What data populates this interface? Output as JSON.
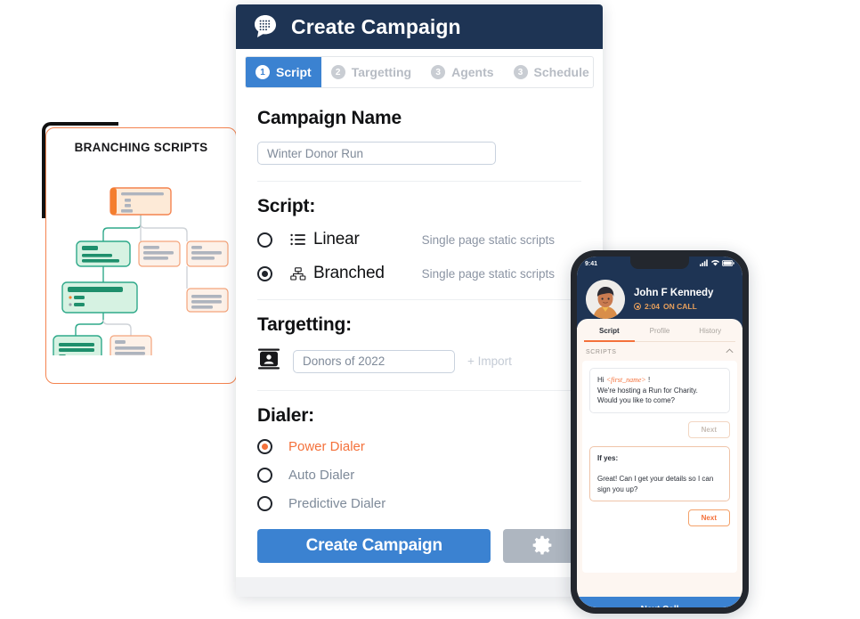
{
  "callout": {
    "title": "BRANCHING SCRIPTS",
    "accent_color": "#F4834F",
    "corner_color": "#111111"
  },
  "card": {
    "header": {
      "title": "Create Campaign",
      "logo_icon": "chat-grid-icon",
      "background_color": "#1E3454"
    },
    "tabs": [
      {
        "num": "1",
        "label": "Script",
        "active": true
      },
      {
        "num": "2",
        "label": "Targetting",
        "active": false
      },
      {
        "num": "3",
        "label": "Agents",
        "active": false
      },
      {
        "num": "3",
        "label": "Schedule",
        "active": false
      }
    ],
    "campaign_name": {
      "title": "Campaign Name",
      "placeholder": "Winter Donor Run",
      "value": ""
    },
    "script": {
      "title": "Script:",
      "options": [
        {
          "label": "Linear",
          "desc": "Single page static scripts",
          "icon": "list-icon",
          "selected": false
        },
        {
          "label": "Branched",
          "desc": "Single page static scripts",
          "icon": "sitemap-icon",
          "selected": true
        }
      ]
    },
    "targetting": {
      "title": "Targetting:",
      "icon": "contact-card-icon",
      "placeholder": "Donors of 2022",
      "value": "",
      "import_label": "+ Import"
    },
    "dialer": {
      "title": "Dialer:",
      "options": [
        {
          "label": "Power Dialer",
          "selected": true
        },
        {
          "label": "Auto Dialer",
          "selected": false
        },
        {
          "label": "Predictive Dialer",
          "selected": false
        }
      ],
      "selected_color": "#F4713B"
    },
    "actions": {
      "primary_label": "Create Campaign",
      "primary_color": "#3B82D1",
      "settings_icon": "gear-icon"
    }
  },
  "phone": {
    "status": {
      "time": "9:41",
      "signal_icon": "signal-bars-icon",
      "wifi_icon": "wifi-icon",
      "battery_icon": "battery-icon"
    },
    "caller": {
      "name": "John F Kennedy",
      "timer": "2:04",
      "state": "ON CALL",
      "avatar_icon": "avatar-icon"
    },
    "tabs": [
      {
        "label": "Script",
        "active": true
      },
      {
        "label": "Profile",
        "active": false
      },
      {
        "label": "History",
        "active": false
      }
    ],
    "scripts_section": {
      "label": "SCRIPTS",
      "collapse_icon": "chevron-up-icon"
    },
    "script_cards": [
      {
        "greeting": "Hi ",
        "variable": "<first_name>",
        "greeting_end": " !",
        "line2": "We're hosting a Run for Charity.",
        "line3": "Would you like to come?",
        "next_label": "Next"
      },
      {
        "heading": "If yes:",
        "line2": "Great! Can I get your details so I can",
        "line3": "sign you up?",
        "next_label": "Next"
      }
    ],
    "next_call_label": "Next Call",
    "next_call_color": "#3B82D1"
  }
}
